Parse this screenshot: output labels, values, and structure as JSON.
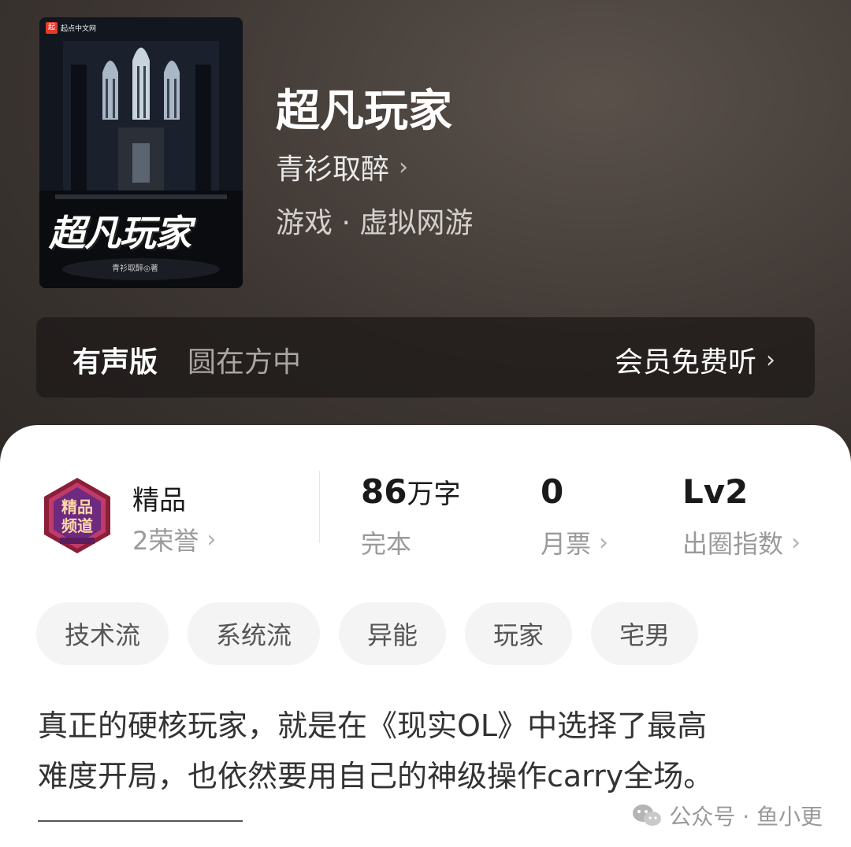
{
  "book": {
    "cover": {
      "brand": "起点中文网",
      "brand_mark": "起",
      "title": "超凡玩家",
      "author": "青衫取醉◎著"
    },
    "title": "超凡玩家",
    "author": "青衫取醉",
    "genre": "游戏 · 虚拟网游"
  },
  "audio": {
    "label": "有声版",
    "narrator": "圆在方中",
    "cta": "会员免费听"
  },
  "stats": {
    "badge_icon": "premium-channel-badge-icon",
    "quality": "精品",
    "honors": "2荣誉",
    "word_count_value": "86",
    "word_count_unit": "万字",
    "status": "完本",
    "monthly_tickets_value": "0",
    "monthly_tickets_label": "月票",
    "level_value": "Lv2",
    "level_label": "出圈指数"
  },
  "tags": [
    "技术流",
    "系统流",
    "异能",
    "玩家",
    "宅男"
  ],
  "description_line1": "真正的硬核玩家，就是在《现实OL》中选择了最高",
  "description_line2": "难度开局，也依然要用自己的神级操作carry全场。",
  "watermark": "公众号 · 鱼小更"
}
